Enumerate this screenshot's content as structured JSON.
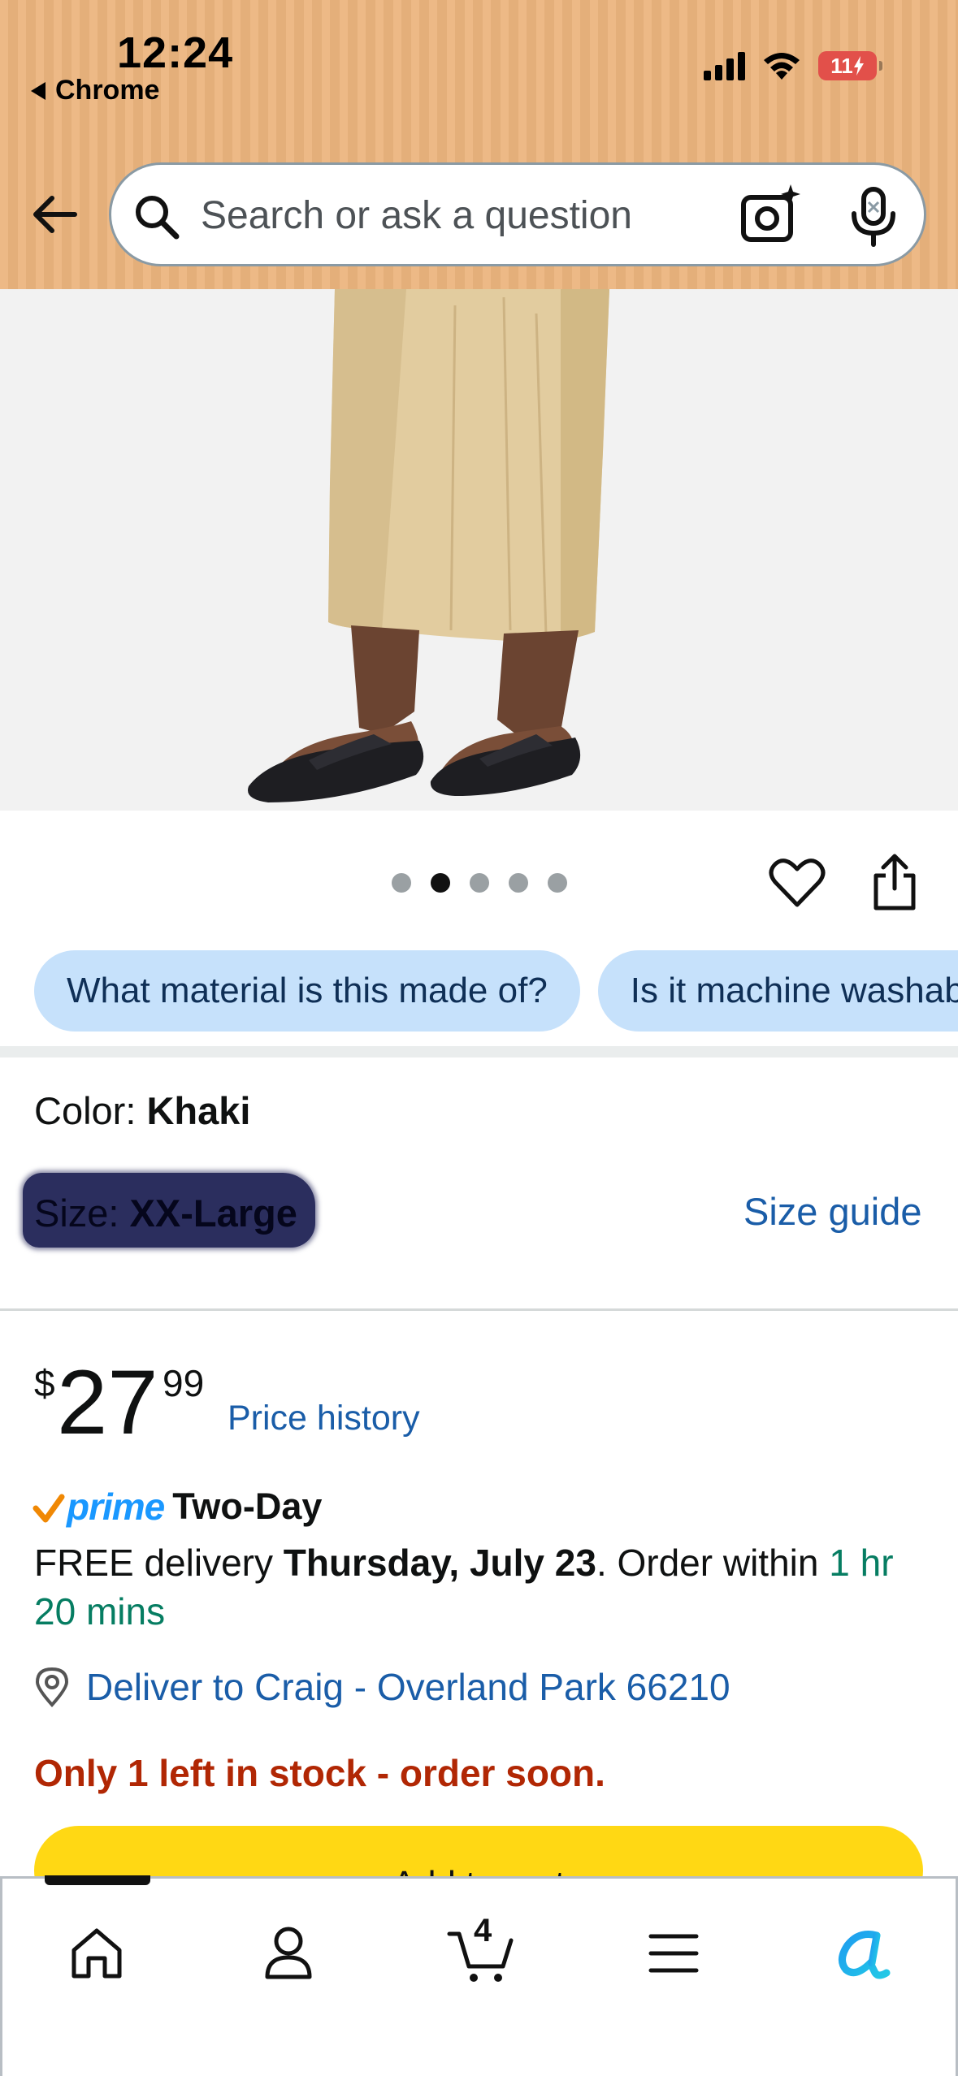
{
  "status_bar": {
    "time": "12:24",
    "back_app": "Chrome",
    "battery": "11"
  },
  "header": {
    "search_placeholder": "Search or ask a question",
    "icons": [
      "back-arrow-icon",
      "search-icon",
      "camera-search-icon",
      "microphone-icon"
    ],
    "background_color": "#ecb57e"
  },
  "gallery": {
    "image_count": 5,
    "active_index": 1
  },
  "question_chips": [
    "What material is this made of?",
    "Is it machine washable?"
  ],
  "variation": {
    "color_label": "Color: ",
    "color_value": "Khaki",
    "size_label": "Size: ",
    "size_value": "XX-Large",
    "size_guide": "Size guide"
  },
  "price": {
    "symbol": "$",
    "whole": "27",
    "fraction": "99",
    "price_history": "Price history"
  },
  "delivery": {
    "prime_label": "prime",
    "prime_speed": "Two-Day",
    "free_text": "FREE delivery ",
    "date": "Thursday, July 23",
    "order_within_text": ". Order within ",
    "countdown": "1 hr 20 mins",
    "deliver_to": "Deliver to Craig - Overland Park 66210"
  },
  "stock": {
    "message": "Only 1 left in stock - order soon."
  },
  "buttons": {
    "add_to_cart": "Add to cart"
  },
  "bottom_nav": {
    "cart_count": "4",
    "items": [
      "home",
      "account",
      "cart",
      "menu",
      "rufus"
    ]
  },
  "colors": {
    "link": "#1a5da8",
    "stock_red": "#b12704",
    "delivery_green": "#067d62",
    "chip_bg": "#c6e1fb",
    "cart_button": "#ffd814",
    "prime_blue": "#1a98ff"
  }
}
